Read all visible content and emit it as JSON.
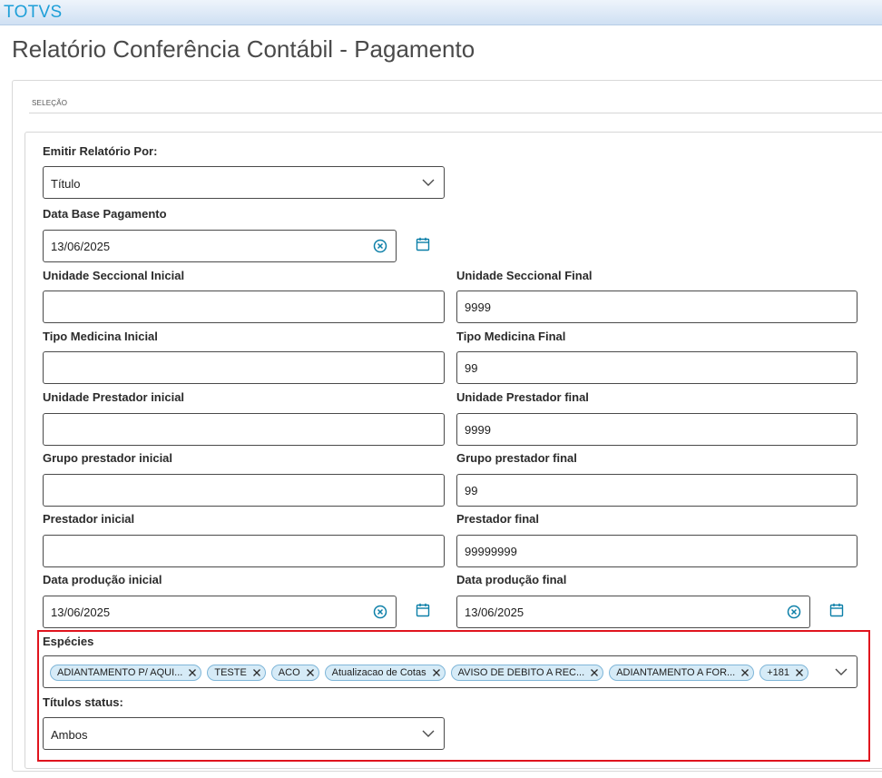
{
  "app": {
    "brand": "TOTVS",
    "title": "Relatório Conferência Contábil - Pagamento"
  },
  "section": {
    "label": "SELEÇÃO"
  },
  "form": {
    "emitir": {
      "label": "Emitir Relatório Por:",
      "value": "Título"
    },
    "data_base": {
      "label": "Data Base Pagamento",
      "value": "13/06/2025"
    },
    "unidade_seccional_inicial": {
      "label": "Unidade Seccional Inicial",
      "value": ""
    },
    "unidade_seccional_final": {
      "label": "Unidade Seccional Final",
      "value": "9999"
    },
    "tipo_medicina_inicial": {
      "label": "Tipo Medicina Inicial",
      "value": ""
    },
    "tipo_medicina_final": {
      "label": "Tipo Medicina Final",
      "value": "99"
    },
    "unidade_prestador_inicial": {
      "label": "Unidade Prestador inicial",
      "value": ""
    },
    "unidade_prestador_final": {
      "label": "Unidade Prestador final",
      "value": "9999"
    },
    "grupo_prestador_inicial": {
      "label": "Grupo prestador inicial",
      "value": ""
    },
    "grupo_prestador_final": {
      "label": "Grupo prestador final",
      "value": "99"
    },
    "prestador_inicial": {
      "label": "Prestador inicial",
      "value": ""
    },
    "prestador_final": {
      "label": "Prestador final",
      "value": "99999999"
    },
    "data_producao_inicial": {
      "label": "Data produção inicial",
      "value": "13/06/2025"
    },
    "data_producao_final": {
      "label": "Data produção final",
      "value": "13/06/2025"
    },
    "especies": {
      "label": "Espécies",
      "chips": [
        "ADIANTAMENTO P/ AQUI...",
        "TESTE",
        "ACO",
        "Atualizacao de Cotas",
        "AVISO DE DEBITO A REC...",
        "ADIANTAMENTO A FOR...",
        "+181"
      ]
    },
    "titulos_status": {
      "label": "Títulos status:",
      "value": "Ambos"
    }
  },
  "colors": {
    "accent": "#0c7fa8",
    "highlight": "#e0141e",
    "chip_bg": "#d6ebf7"
  }
}
